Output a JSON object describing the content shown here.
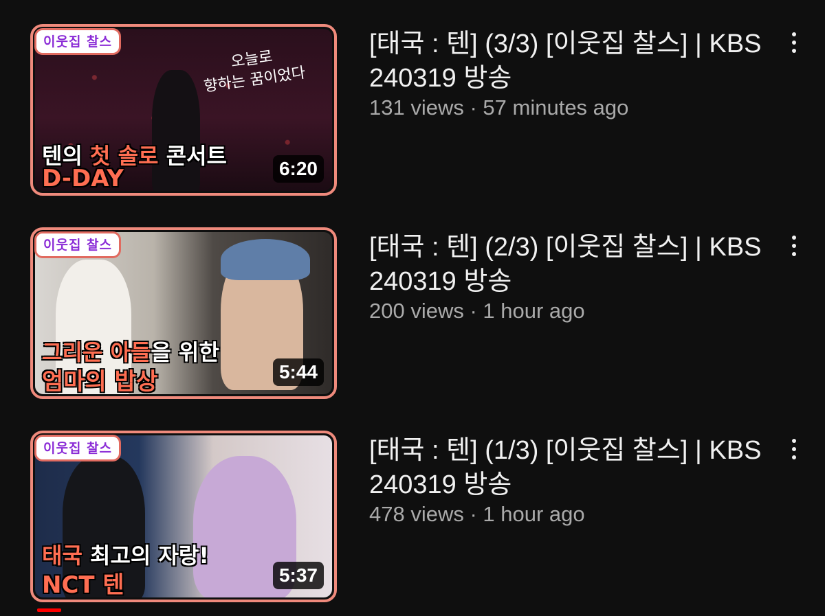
{
  "videos": [
    {
      "badge": "이웃집 찰스",
      "overlay_line1_a": "텐의 ",
      "overlay_line1_b": "첫 솔로",
      "overlay_line1_c": " 콘서트",
      "overlay_line2": "D-DAY",
      "handwriting_line1": "오늘로",
      "handwriting_line2": "향하는 꿈이었다",
      "duration": "6:20",
      "title": "[태국 : 텐] (3/3) [이웃집 찰스] | KBS 240319 방송",
      "views": "131 views",
      "separator": " · ",
      "time": "57 minutes ago"
    },
    {
      "badge": "이웃집 찰스",
      "overlay_line1_a": "그리운 아들",
      "overlay_line1_b": "을 위한",
      "overlay_line2": "엄마의 밥상",
      "duration": "5:44",
      "title": "[태국 : 텐] (2/3) [이웃집 찰스] | KBS 240319 방송",
      "views": "200 views",
      "separator": " · ",
      "time": "1 hour ago"
    },
    {
      "badge": "이웃집 찰스",
      "overlay_line1_a": "태국",
      "overlay_line1_b": " 최고의 자랑!",
      "overlay_line2": "NCT 텐",
      "duration": "5:37",
      "title": "[태국 : 텐] (1/3) [이웃집 찰스] | KBS 240319 방송",
      "views": "478 views",
      "separator": " · ",
      "time": "1 hour ago",
      "watch_progress": 0.08
    }
  ],
  "colors": {
    "background": "#0f0f0f",
    "thumb_border": "#ef8a7c",
    "accent": "#ff6e52",
    "meta_text": "#aaaaaa",
    "progress": "#ff0000"
  }
}
